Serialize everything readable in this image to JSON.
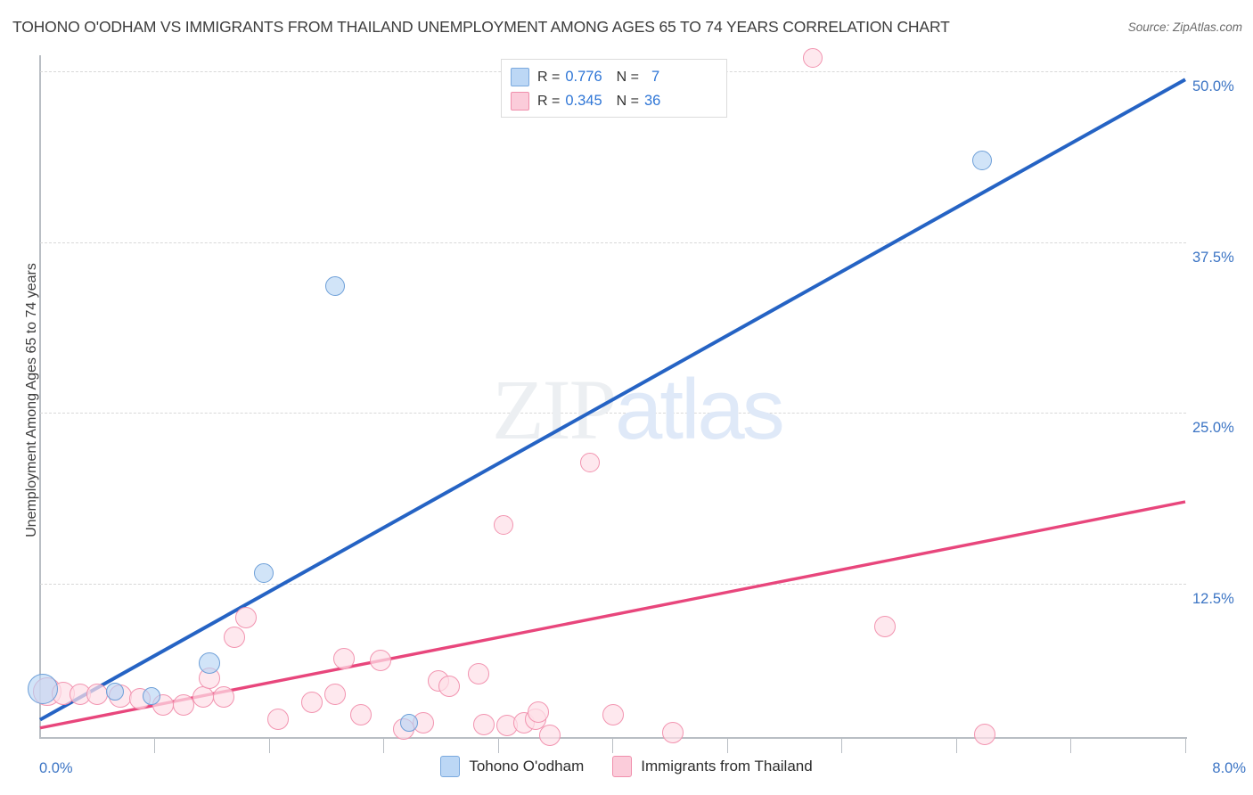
{
  "header": {
    "title": "TOHONO O'ODHAM VS IMMIGRANTS FROM THAILAND UNEMPLOYMENT AMONG AGES 65 TO 74 YEARS CORRELATION CHART",
    "source": "Source: ZipAtlas.com"
  },
  "watermark": {
    "zip": "ZIP",
    "atlas": "atlas"
  },
  "stats": {
    "blue": {
      "r_label": "R =",
      "r_value": "0.776",
      "n_label": "N =",
      "n_value": "7"
    },
    "pink": {
      "r_label": "R =",
      "r_value": "0.345",
      "n_label": "N =",
      "n_value": "36"
    }
  },
  "legend": {
    "blue_label": "Tohono O'odham",
    "pink_label": "Immigrants from Thailand"
  },
  "axes": {
    "y_title": "Unemployment Among Ages 65 to 74 years",
    "y_ticks": [
      "50.0%",
      "37.5%",
      "25.0%",
      "12.5%"
    ],
    "x_min": "0.0%",
    "x_max": "8.0%"
  },
  "chart_data": {
    "type": "scatter",
    "title": "TOHONO O'ODHAM VS IMMIGRANTS FROM THAILAND UNEMPLOYMENT AMONG AGES 65 TO 74 YEARS CORRELATION CHART",
    "xlabel": "",
    "ylabel": "Unemployment Among Ages 65 to 74 years",
    "xlim": [
      0.0,
      8.0
    ],
    "ylim": [
      0.0,
      53.3
    ],
    "x_tick_labels": [
      "0.0%",
      "8.0%"
    ],
    "y_tick_labels": [
      "12.5%",
      "25.0%",
      "37.5%",
      "50.0%"
    ],
    "y_tick_values": [
      12.5,
      25.0,
      37.5,
      50.0
    ],
    "grid": true,
    "legend_position": "bottom-center",
    "series": [
      {
        "name": "Tohono O'odham",
        "color": "#b5d4f3",
        "edge_color": "#6d9fd8",
        "R": 0.776,
        "N": 7,
        "points": [
          {
            "x": 0.02,
            "y": 4.8,
            "r": 17
          },
          {
            "x": 0.52,
            "y": 4.6,
            "r": 10
          },
          {
            "x": 0.78,
            "y": 4.3,
            "r": 10
          },
          {
            "x": 1.18,
            "y": 6.7,
            "r": 12
          },
          {
            "x": 1.56,
            "y": 13.3,
            "r": 11
          },
          {
            "x": 2.06,
            "y": 34.3,
            "r": 11
          },
          {
            "x": 2.58,
            "y": 2.3,
            "r": 10
          },
          {
            "x": 6.58,
            "y": 43.5,
            "r": 11
          }
        ],
        "trend": {
          "x0": 0.0,
          "y0": 2.55,
          "x1": 8.0,
          "y1": 49.4
        }
      },
      {
        "name": "Immigrants from Thailand",
        "color": "#fddfe8",
        "edge_color": "#f294b0",
        "R": 0.345,
        "N": 36,
        "points": [
          {
            "x": 0.05,
            "y": 4.6,
            "r": 16
          },
          {
            "x": 0.16,
            "y": 4.5,
            "r": 13
          },
          {
            "x": 0.28,
            "y": 4.4,
            "r": 12
          },
          {
            "x": 0.4,
            "y": 4.4,
            "r": 12
          },
          {
            "x": 0.56,
            "y": 4.3,
            "r": 13
          },
          {
            "x": 0.7,
            "y": 4.1,
            "r": 12
          },
          {
            "x": 0.86,
            "y": 3.6,
            "r": 12
          },
          {
            "x": 1.0,
            "y": 3.6,
            "r": 12
          },
          {
            "x": 1.14,
            "y": 4.2,
            "r": 12
          },
          {
            "x": 1.18,
            "y": 5.6,
            "r": 12
          },
          {
            "x": 1.28,
            "y": 4.2,
            "r": 12
          },
          {
            "x": 1.36,
            "y": 8.6,
            "r": 12
          },
          {
            "x": 1.44,
            "y": 10.0,
            "r": 12
          },
          {
            "x": 1.66,
            "y": 2.6,
            "r": 12
          },
          {
            "x": 1.9,
            "y": 3.8,
            "r": 12
          },
          {
            "x": 2.06,
            "y": 4.4,
            "r": 12
          },
          {
            "x": 2.12,
            "y": 7.0,
            "r": 12
          },
          {
            "x": 2.24,
            "y": 2.9,
            "r": 12
          },
          {
            "x": 2.38,
            "y": 6.9,
            "r": 12
          },
          {
            "x": 2.54,
            "y": 1.9,
            "r": 12
          },
          {
            "x": 2.68,
            "y": 2.3,
            "r": 12
          },
          {
            "x": 2.78,
            "y": 5.4,
            "r": 12
          },
          {
            "x": 2.86,
            "y": 5.0,
            "r": 12
          },
          {
            "x": 3.06,
            "y": 5.9,
            "r": 12
          },
          {
            "x": 3.1,
            "y": 2.2,
            "r": 12
          },
          {
            "x": 3.26,
            "y": 2.1,
            "r": 12
          },
          {
            "x": 3.38,
            "y": 2.3,
            "r": 12
          },
          {
            "x": 3.46,
            "y": 2.6,
            "r": 12
          },
          {
            "x": 3.56,
            "y": 1.4,
            "r": 12
          },
          {
            "x": 3.24,
            "y": 16.8,
            "r": 11
          },
          {
            "x": 3.84,
            "y": 21.4,
            "r": 11
          },
          {
            "x": 3.48,
            "y": 3.1,
            "r": 12
          },
          {
            "x": 4.0,
            "y": 2.9,
            "r": 12
          },
          {
            "x": 4.42,
            "y": 1.6,
            "r": 12
          },
          {
            "x": 5.4,
            "y": 51.0,
            "r": 11
          },
          {
            "x": 5.9,
            "y": 9.4,
            "r": 12
          },
          {
            "x": 6.6,
            "y": 1.5,
            "r": 12
          }
        ],
        "trend": {
          "x0": 0.0,
          "y0": 1.95,
          "x1": 8.0,
          "y1": 18.5
        }
      }
    ]
  },
  "colors": {
    "blue_accent": "#2f76d6",
    "blue_trend": "#2563c4",
    "pink_trend": "#e8467c",
    "tick_text": "#3b74c4"
  }
}
